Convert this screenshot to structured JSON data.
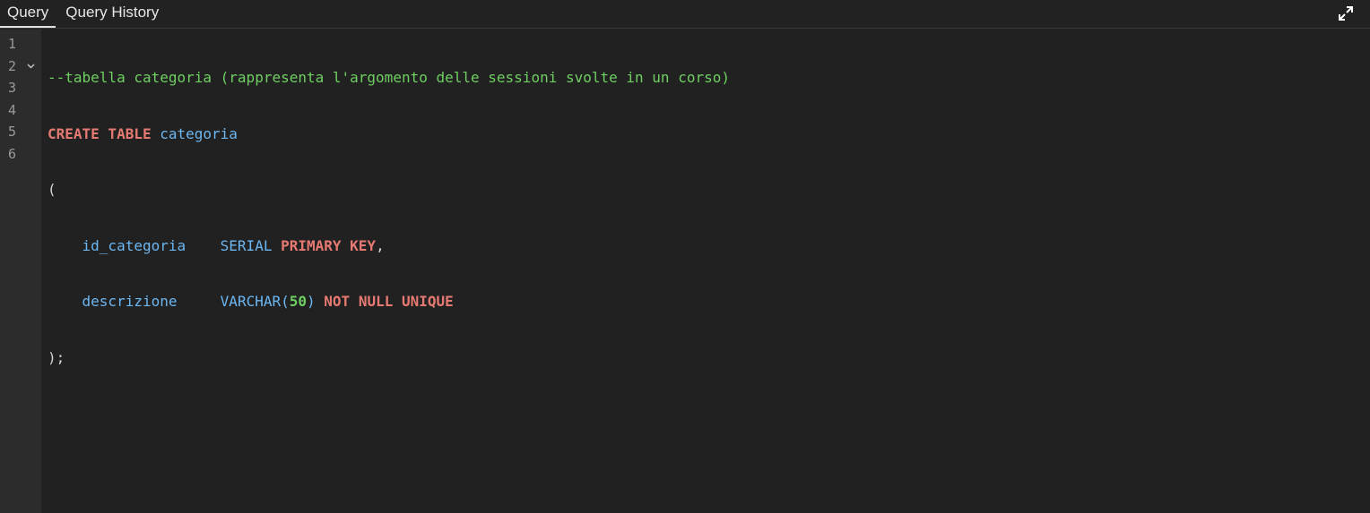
{
  "tabs": [
    {
      "label": "Query",
      "active": true
    },
    {
      "label": "Query History",
      "active": false
    }
  ],
  "toolbar": {
    "expand_icon": "expand-icon"
  },
  "editor": {
    "line_numbers": [
      "1",
      "2",
      "3",
      "4",
      "5",
      "6"
    ],
    "lines": {
      "l1": {
        "comment": "--tabella categoria (rappresenta l'argomento delle sessioni svolte in un corso)"
      },
      "l2": {
        "kw1": "CREATE TABLE",
        "name": "categoria"
      },
      "l3": {
        "paren": "("
      },
      "l4": {
        "indent": "    ",
        "col": "id_categoria",
        "gap": "    ",
        "type": "SERIAL",
        "kw": "PRIMARY KEY",
        "punct": ","
      },
      "l5": {
        "indent": "    ",
        "col": "descrizione",
        "gap": "     ",
        "type": "VARCHAR(",
        "num": "50",
        "close": ")",
        "kw": "NOT NULL UNIQUE"
      },
      "l6": {
        "end": ");"
      }
    }
  },
  "colors": {
    "comment": "#6fcf62",
    "keyword": "#e67a72",
    "identifier": "#6cb6f1",
    "number": "#6fcf62",
    "background": "#212121",
    "gutter": "#2c2c2c"
  }
}
